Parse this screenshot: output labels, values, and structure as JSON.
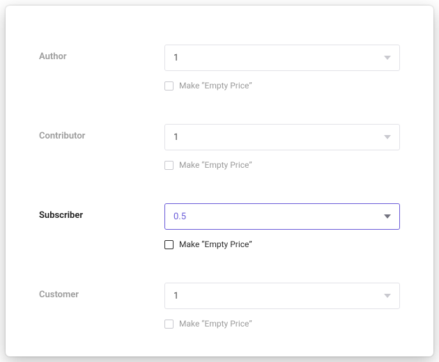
{
  "roles": [
    {
      "label": "Author",
      "select_value": "1",
      "checkbox_label": "Make “Empty Price”",
      "active": false
    },
    {
      "label": "Contributor",
      "select_value": "1",
      "checkbox_label": "Make “Empty Price”",
      "active": false
    },
    {
      "label": "Subscriber",
      "select_value": "0.5",
      "checkbox_label": "Make “Empty Price”",
      "active": true
    },
    {
      "label": "Customer",
      "select_value": "1",
      "checkbox_label": "Make “Empty Price”",
      "active": false
    }
  ],
  "colors": {
    "accent": "#6a5bd8",
    "muted": "#9b9b9b",
    "border": "#e2e2e7",
    "text": "#1b1b1b"
  }
}
